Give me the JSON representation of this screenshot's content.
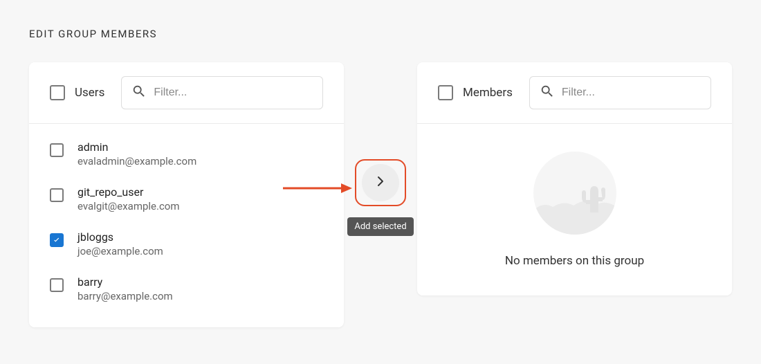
{
  "title": "EDIT GROUP MEMBERS",
  "users_panel": {
    "label": "Users",
    "filter_placeholder": "Filter...",
    "items": [
      {
        "name": "admin",
        "email": "evaladmin@example.com",
        "checked": false
      },
      {
        "name": "git_repo_user",
        "email": "evalgit@example.com",
        "checked": false
      },
      {
        "name": "jbloggs",
        "email": "joe@example.com",
        "checked": true
      },
      {
        "name": "barry",
        "email": "barry@example.com",
        "checked": false
      }
    ]
  },
  "members_panel": {
    "label": "Members",
    "filter_placeholder": "Filter...",
    "empty_text": "No members on this group"
  },
  "transfer": {
    "tooltip": "Add selected"
  }
}
